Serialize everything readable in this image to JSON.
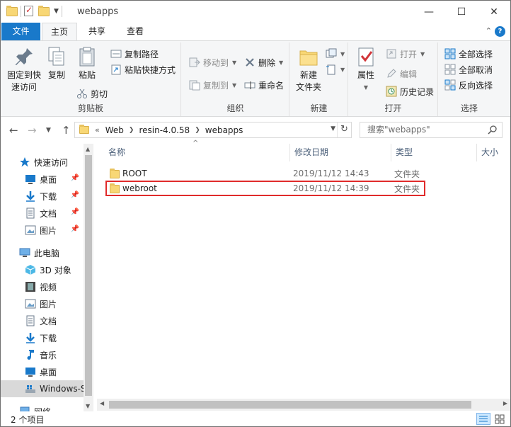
{
  "window": {
    "title": "webapps",
    "minimize": "—",
    "maximize": "☐",
    "close": "✕"
  },
  "ribbon_tabs": {
    "file": "文件",
    "home": "主页",
    "share": "共享",
    "view": "查看",
    "collapse": "⌃",
    "help": "?"
  },
  "ribbon": {
    "clipboard": {
      "label": "剪贴板",
      "pin_quick_access_1": "固定到快",
      "pin_quick_access_2": "速访问",
      "copy": "复制",
      "paste": "粘贴",
      "copy_path": "复制路径",
      "paste_shortcut": "粘贴快捷方式",
      "cut": "剪切"
    },
    "organize": {
      "label": "组织",
      "move_to": "移动到",
      "copy_to": "复制到",
      "delete": "删除",
      "rename": "重命名"
    },
    "new": {
      "label": "新建",
      "new_folder_1": "新建",
      "new_folder_2": "文件夹"
    },
    "open": {
      "label": "打开",
      "properties": "属性",
      "open": "打开",
      "edit": "编辑",
      "history": "历史记录"
    },
    "select": {
      "label": "选择",
      "select_all": "全部选择",
      "select_none": "全部取消",
      "invert": "反向选择"
    }
  },
  "address": {
    "overflow": "«",
    "crumbs": [
      "Web",
      "resin-4.0.58",
      "webapps"
    ],
    "search_placeholder": "搜索\"webapps\""
  },
  "nav": {
    "quick_access": "快速访问",
    "qa_items": [
      "桌面",
      "下载",
      "文档",
      "图片"
    ],
    "this_pc": "此电脑",
    "pc_items": [
      "3D 对象",
      "视频",
      "图片",
      "文档",
      "下载",
      "音乐",
      "桌面",
      "Windows-SSD"
    ],
    "network": "网络"
  },
  "columns": {
    "name": "名称",
    "date": "修改日期",
    "type": "类型",
    "size": "大小"
  },
  "files": [
    {
      "name": "ROOT",
      "date": "2019/11/12 14:43",
      "type": "文件夹"
    },
    {
      "name": "webroot",
      "date": "2019/11/12 14:39",
      "type": "文件夹"
    }
  ],
  "status": {
    "count": "2 个项目"
  },
  "colors": {
    "accent": "#1979ca",
    "highlight_border": "#e02b2b",
    "folder": "#f8d775"
  }
}
